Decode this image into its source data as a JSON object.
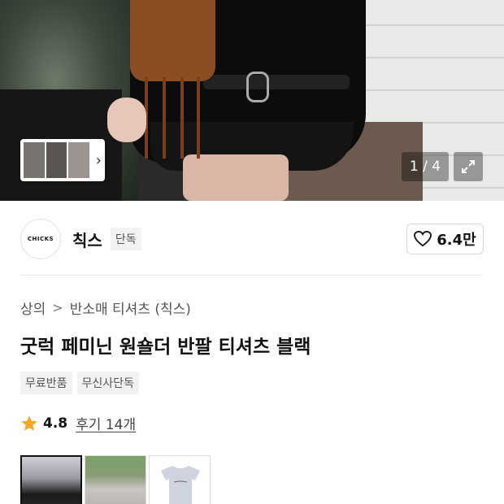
{
  "hero": {
    "pager_text": "1 / 4",
    "icons": {
      "chevron": "chevron-right-icon",
      "expand": "expand-icon"
    }
  },
  "brand": {
    "logo_text": "CHICKS",
    "name": "칙스",
    "tag": "단독",
    "likes": "6.4만"
  },
  "breadcrumb": {
    "category": "상의",
    "subcategory": "반소매 티셔츠 (칙스)"
  },
  "product": {
    "title": "굿럭 페미닌 원숄더 반팔 티셔츠 블랙",
    "tags": [
      "무료반품",
      "무신사단독"
    ]
  },
  "rating": {
    "score": "4.8",
    "reviews": "후기 14개"
  },
  "colors": {
    "star": "#f5a623",
    "text": "#111111"
  }
}
